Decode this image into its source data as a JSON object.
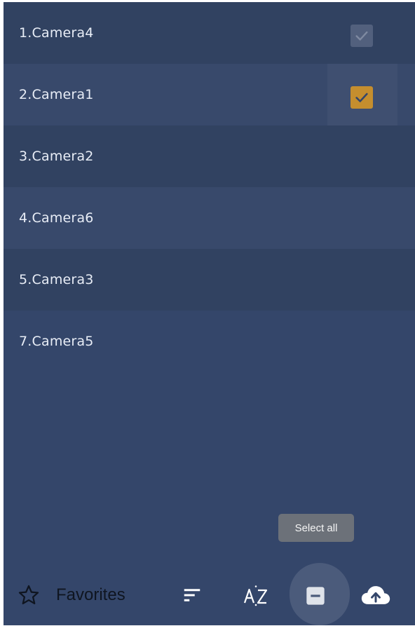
{
  "cameras": [
    {
      "label": "1.Camera4",
      "checkbox": "disabled-checked"
    },
    {
      "label": "2.Camera1",
      "checkbox": "checked"
    },
    {
      "label": "3.Camera2",
      "checkbox": "none"
    },
    {
      "label": "4.Camera6",
      "checkbox": "none"
    },
    {
      "label": "5.Camera3",
      "checkbox": "none"
    },
    {
      "label": "7.Camera5",
      "checkbox": "none"
    }
  ],
  "tooltip": {
    "text": "Select all"
  },
  "toolbar": {
    "favorites_label": "Favorites",
    "icons": [
      "star-outline-icon",
      "sort-icon",
      "sort-az-icon",
      "select-all-icon",
      "cloud-upload-icon"
    ]
  },
  "colors": {
    "panel_background": "#34466a",
    "checkbox_checked": "#c58e2e",
    "checkbox_disabled": "#52607d",
    "tooltip_background": "#6c7179"
  }
}
